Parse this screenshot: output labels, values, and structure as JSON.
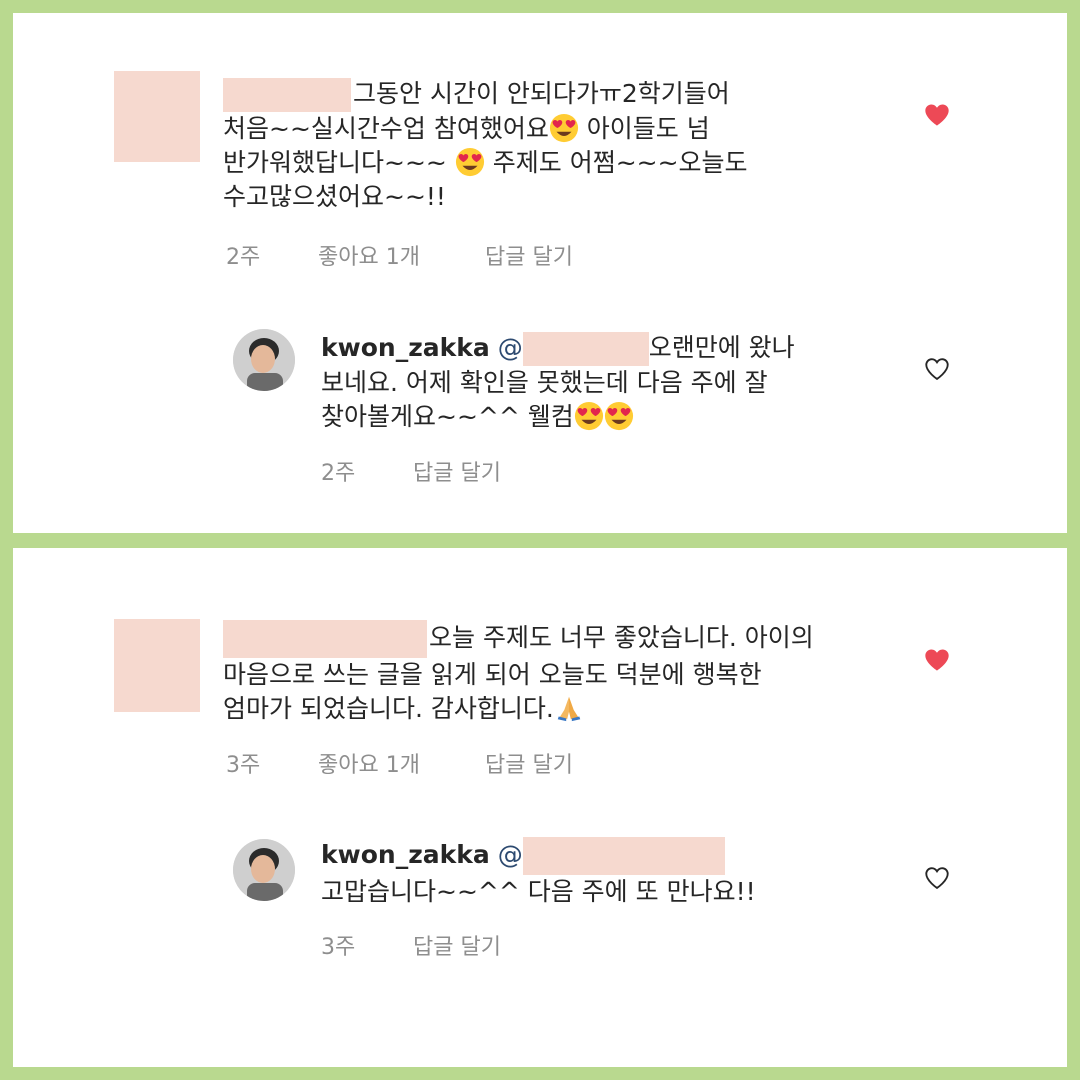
{
  "panels": [
    {
      "comment": {
        "text_line1": "그동안 시간이 안되다가ㅠ2학기들어",
        "text_line2a": "처음~~실시간수업 참여했어요",
        "text_line2b": " 아이들도 넘",
        "text_line3a": "반가워했답니다~~~ ",
        "text_line3b": " 주제도 어쩜~~~오늘도",
        "text_line4": "수고많으셨어요~~!!",
        "time": "2주",
        "likes": "좋아요 1개",
        "reply": "답글 달기",
        "liked": true
      },
      "reply": {
        "username": "kwon_zakka",
        "at": "@",
        "text_line1": "오랜만에 왔나",
        "text_line2": "보네요. 어제 확인을 못했는데 다음 주에 잘",
        "text_line3": "찾아볼게요~~^^ 웰컴",
        "time": "2주",
        "reply": "답글 달기",
        "liked": false
      }
    },
    {
      "comment": {
        "text_line1": "오늘 주제도 너무 좋았습니다. 아이의",
        "text_line2": "마음으로 쓰는 글을 읽게 되어 오늘도 덕분에 행복한",
        "text_line3": "엄마가 되었습니다. 감사합니다.",
        "time": "3주",
        "likes": "좋아요 1개",
        "reply": "답글 달기",
        "liked": true
      },
      "reply": {
        "username": "kwon_zakka",
        "at": "@",
        "text_line1": "고맙습니다~~^^ 다음 주에 또 만나요!!",
        "time": "3주",
        "reply": "답글 달기",
        "liked": false
      }
    }
  ],
  "colors": {
    "background": "#b9d98f",
    "heart_liked": "#ed4956",
    "redaction": "#f6d9cf",
    "meta_text": "#8e8e8e"
  },
  "icons": {
    "heart_liked": "heart-filled-icon",
    "heart_unliked": "heart-outline-icon",
    "emoji_heart_eyes": "heart-eyes-emoji",
    "emoji_pray": "folded-hands-emoji"
  }
}
